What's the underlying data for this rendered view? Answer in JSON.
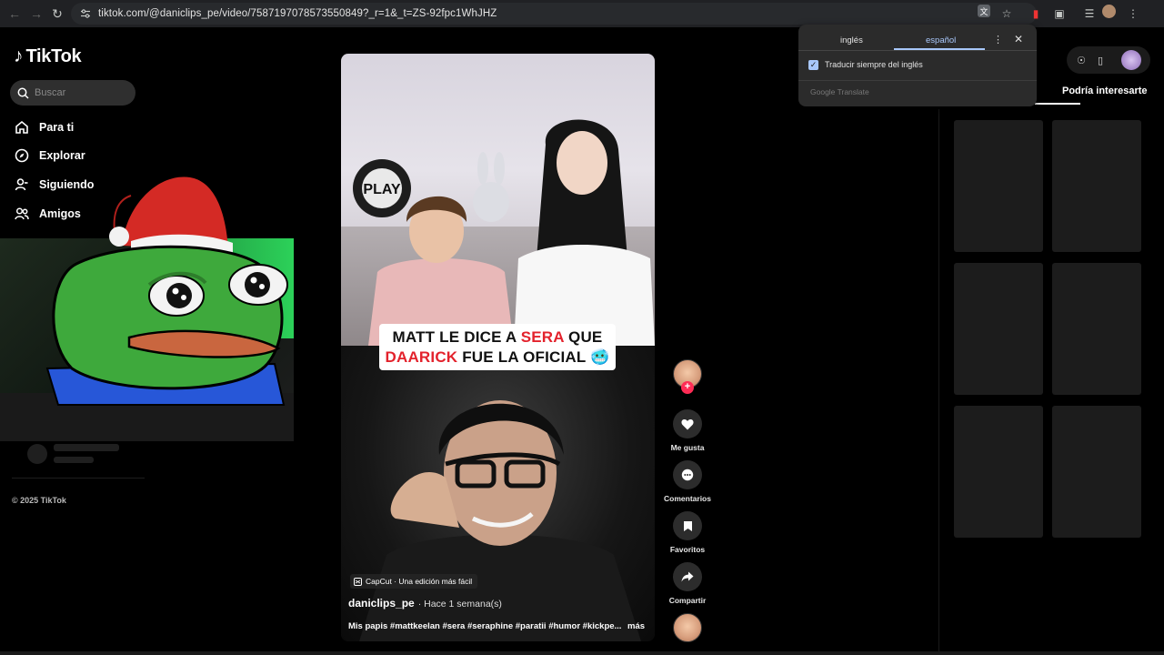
{
  "browser": {
    "url": "tiktok.com/@daniclips_pe/video/7587197078573550849?_r=1&_t=ZS-92fpc1WhJHZ"
  },
  "translate_popup": {
    "source_lang": "inglés",
    "target_lang": "español",
    "always_translate_label": "Traducir siempre del inglés",
    "always_translate_checked": true,
    "brand": "Google Translate"
  },
  "sidebar": {
    "logo_text": "TikTok",
    "search_placeholder": "Buscar",
    "items": [
      {
        "label": "Para ti",
        "icon": "home-icon"
      },
      {
        "label": "Explorar",
        "icon": "compass-icon"
      },
      {
        "label": "Siguiendo",
        "icon": "user-follow-icon"
      },
      {
        "label": "Amigos",
        "icon": "friends-icon"
      }
    ],
    "copyright": "© 2025 TikTok"
  },
  "video": {
    "caption_line1": {
      "a": "MATT LE DICE A ",
      "b": "SERA",
      "c": " QUE"
    },
    "caption_line2": {
      "a": "DAARICK",
      "b": " FUE LA OFICIAL",
      "emoji": "🥶"
    },
    "capcut_label": "CapCut · Una edición más fácil",
    "author": "daniclips_pe",
    "time": "· Hace 1 semana(s)",
    "description": "Mis papis #mattkeelan #sera #seraphine #paratii #humor #kickpe...",
    "more": "más"
  },
  "actions": {
    "like_label": "Me gusta",
    "comments_label": "Comentarios",
    "favorites_label": "Favoritos",
    "share_label": "Compartir"
  },
  "right_panel": {
    "tab_label": "Podría interesarte"
  },
  "colors": {
    "accent": "#fe2c55",
    "caption_red": "#e3222c",
    "translate_blue": "#a8c7fa"
  }
}
